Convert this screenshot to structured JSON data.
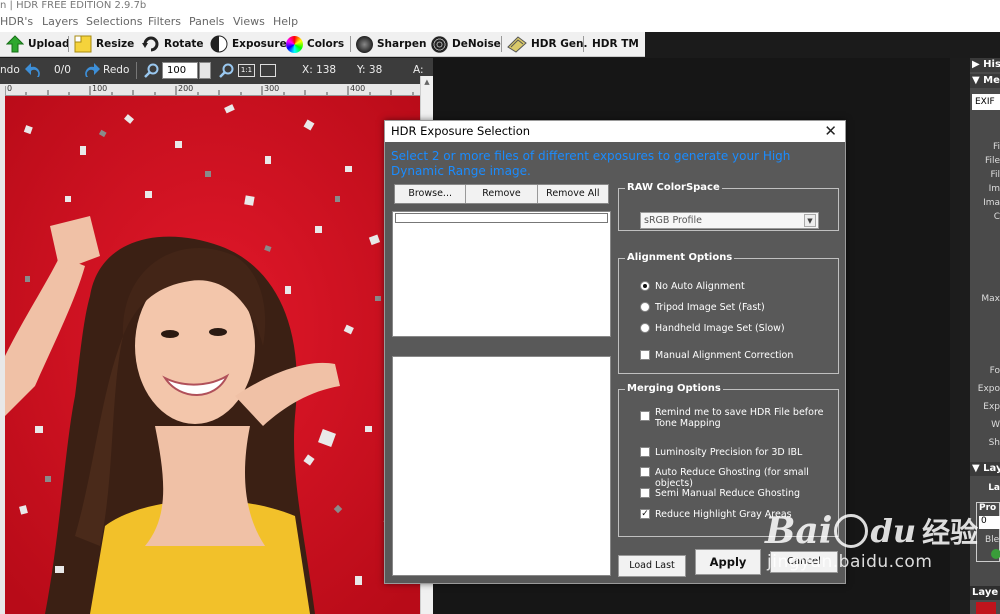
{
  "window": {
    "title": "n | HDR FREE EDITION 2.9.7b"
  },
  "menu": [
    "HDR's",
    "Layers",
    "Selections",
    "Filters",
    "Panels",
    "Views",
    "Help"
  ],
  "toolbar": {
    "upload": "Upload",
    "resize": "Resize",
    "rotate": "Rotate",
    "exposure": "Exposure",
    "colors": "Colors",
    "sharpen": "Sharpen",
    "denoise": "DeNoise",
    "hdr_gen": "HDR Gen.",
    "hdr_tm": "HDR TM"
  },
  "subbar": {
    "undo": "ndo",
    "counter": "0/0",
    "redo": "Redo",
    "zoom": "100",
    "x_label": "X: 138",
    "y_label": "Y: 38",
    "a_label": "A:"
  },
  "ruler": {
    "ticks": [
      "0",
      "100",
      "200",
      "300",
      "400"
    ]
  },
  "side_panel": {
    "histogram": "Hist",
    "meta": "Met",
    "exif": "EXIF",
    "labels": [
      "Fi",
      "File",
      "Fil",
      "Im",
      "Ima",
      "C",
      "Max",
      "Fo",
      "Expo",
      "Exp",
      "W",
      "Sh"
    ],
    "layers": "Lay",
    "layers_sub": "La",
    "props": "Pro",
    "props_val": "0",
    "blend": "Ble",
    "layers2": "Laye"
  },
  "dialog": {
    "title": "HDR Exposure Selection",
    "instruction": "Select 2 or more files of different exposures to generate your High Dynamic Range image.",
    "browse": "Browse...",
    "remove": "Remove",
    "remove_all": "Remove All",
    "raw": {
      "title": "RAW ColorSpace",
      "selected": "sRGB Profile"
    },
    "alignment": {
      "title": "Alignment Options",
      "no_auto": "No Auto Alignment",
      "tripod": "Tripod Image Set (Fast)",
      "handheld": "Handheld Image Set (Slow)",
      "manual": "Manual Alignment Correction"
    },
    "merging": {
      "title": "Merging Options",
      "remind": "Remind me to save HDR File before Tone Mapping",
      "luminosity": "Luminosity Precision for 3D IBL",
      "auto_ghost": "Auto Reduce Ghosting (for small objects)",
      "semi_ghost": "Semi Manual Reduce Ghosting",
      "highlight": "Reduce Highlight Gray Areas"
    },
    "load_last": "Load Last",
    "apply": "Apply",
    "cancel": "Cancel"
  },
  "watermark": {
    "brand": "Bai",
    "paw": "du",
    "cn": "经验",
    "url": "jingyan.baidu.com"
  },
  "colors": {
    "accent": "#1a8cff",
    "dialog_bg": "#595959",
    "photo_bg": "#d4121e"
  }
}
